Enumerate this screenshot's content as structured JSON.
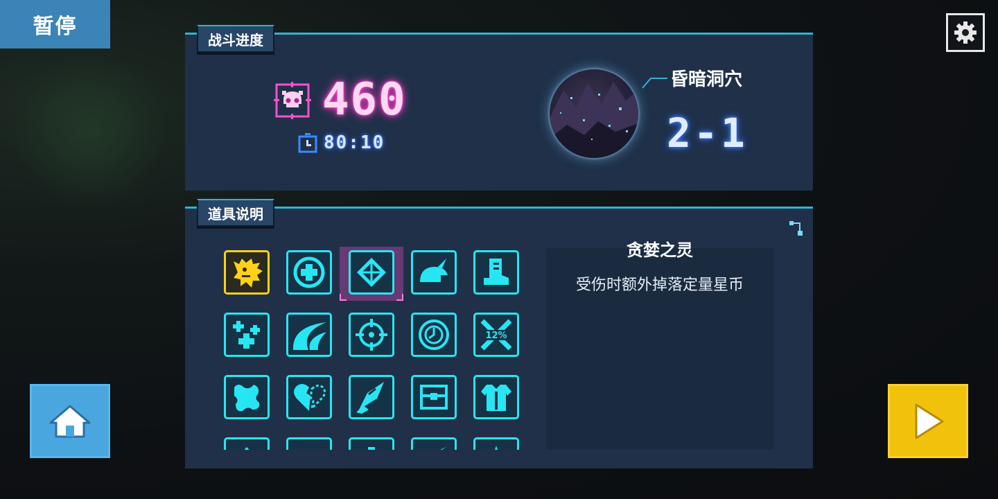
{
  "pause": {
    "label": "暂停"
  },
  "progress": {
    "tab_label": "战斗进度",
    "kill_count": "460",
    "time": "80:10",
    "stage": {
      "name": "昏暗洞穴",
      "number": "2-1"
    }
  },
  "items": {
    "tab_label": "道具说明",
    "grid": [
      "greed-spirit",
      "medkit",
      "diamond-shield",
      "helmet",
      "boot",
      "multi-heal",
      "wave",
      "crosshair",
      "dial",
      "crit-12",
      "puzzle",
      "broken-heart",
      "drill",
      "chest",
      "armor",
      "row4-1",
      "row4-2",
      "row4-3",
      "row4-4",
      "row4-5"
    ],
    "crit_label": "12%",
    "selected": {
      "title": "贪婪之灵",
      "description": "受伤时额外掉落定量星币"
    }
  },
  "colors": {
    "accent_cyan": "#27e6f3",
    "kill_pink": "#ff3ec8",
    "gold": "#ffd21a",
    "home_blue": "#4aa6de",
    "play_yellow": "#f1c20c"
  },
  "icons": {
    "settings": "gear-icon",
    "home": "home-icon",
    "play": "play-icon",
    "kills": "skull-icon",
    "timer": "stopwatch-icon"
  }
}
